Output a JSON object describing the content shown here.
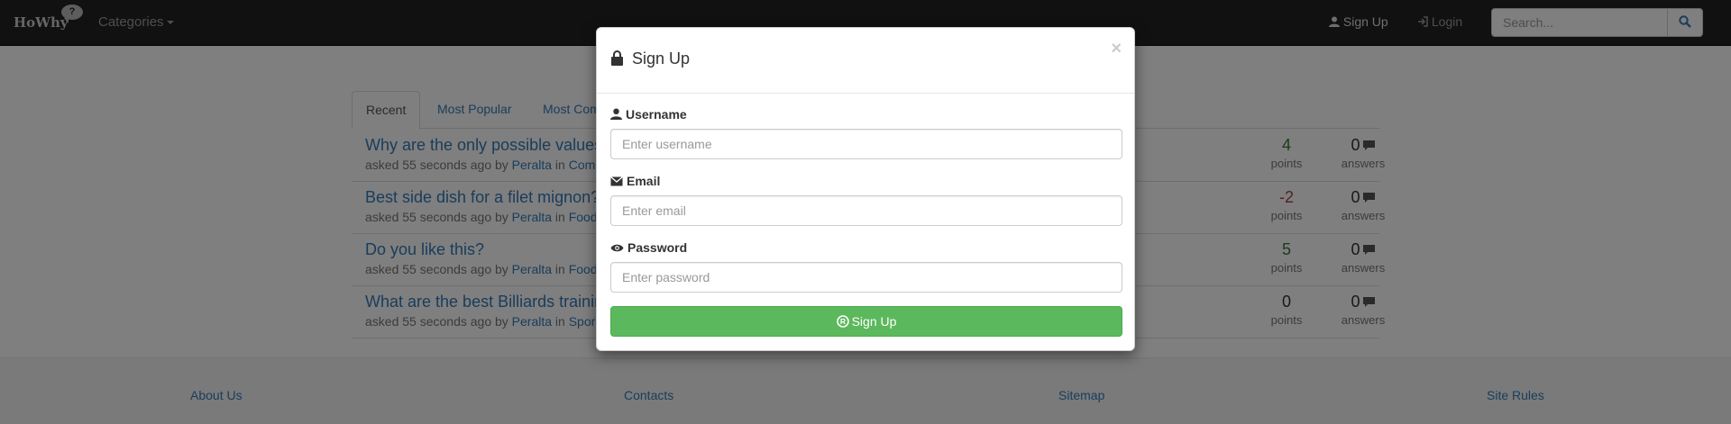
{
  "navbar": {
    "brand": "HoWhy",
    "brand_bubble": "?",
    "categories": "Categories",
    "signup": "Sign Up",
    "login": "Login",
    "search_placeholder": "Search..."
  },
  "tabs": [
    {
      "label": "Recent",
      "active": true
    },
    {
      "label": "Most Popular",
      "active": false
    },
    {
      "label": "Most Com",
      "active": false
    }
  ],
  "questions": [
    {
      "title": "Why are the only possible values",
      "asked": "asked 55 seconds ago by ",
      "author": "Peralta",
      "in": " in ",
      "category": "Com",
      "points": "4",
      "points_label": "points",
      "answers": "0",
      "answers_label": "answers",
      "status": "positive"
    },
    {
      "title": "Best side dish for a filet mignon?",
      "asked": "asked 55 seconds ago by ",
      "author": "Peralta",
      "in": " in ",
      "category": "Food",
      "points": "-2",
      "points_label": "points",
      "answers": "0",
      "answers_label": "answers",
      "status": "negative"
    },
    {
      "title": "Do you like this?",
      "asked": "asked 55 seconds ago by ",
      "author": "Peralta",
      "in": " in ",
      "category": "Food",
      "points": "5",
      "points_label": "points",
      "answers": "0",
      "answers_label": "answers",
      "status": "positive"
    },
    {
      "title": "What are the best Billiards trainin",
      "asked": "asked 55 seconds ago by ",
      "author": "Peralta",
      "in": " in ",
      "category": "Spor",
      "points": "0",
      "points_label": "points",
      "answers": "0",
      "answers_label": "answers",
      "status": "zero"
    }
  ],
  "footer": {
    "about": "About Us",
    "contacts": "Contacts",
    "sitemap": "Sitemap",
    "rules": "Site Rules"
  },
  "modal": {
    "title": "Sign Up",
    "close": "×",
    "username_label": "Username",
    "username_placeholder": "Enter username",
    "email_label": "Email",
    "email_placeholder": "Enter email",
    "password_label": "Password",
    "password_placeholder": "Enter password",
    "submit": "Sign Up"
  },
  "colors": {
    "success": "#5cb85c",
    "link": "#337ab7",
    "positive": "#3c763d",
    "negative": "#a94442"
  }
}
